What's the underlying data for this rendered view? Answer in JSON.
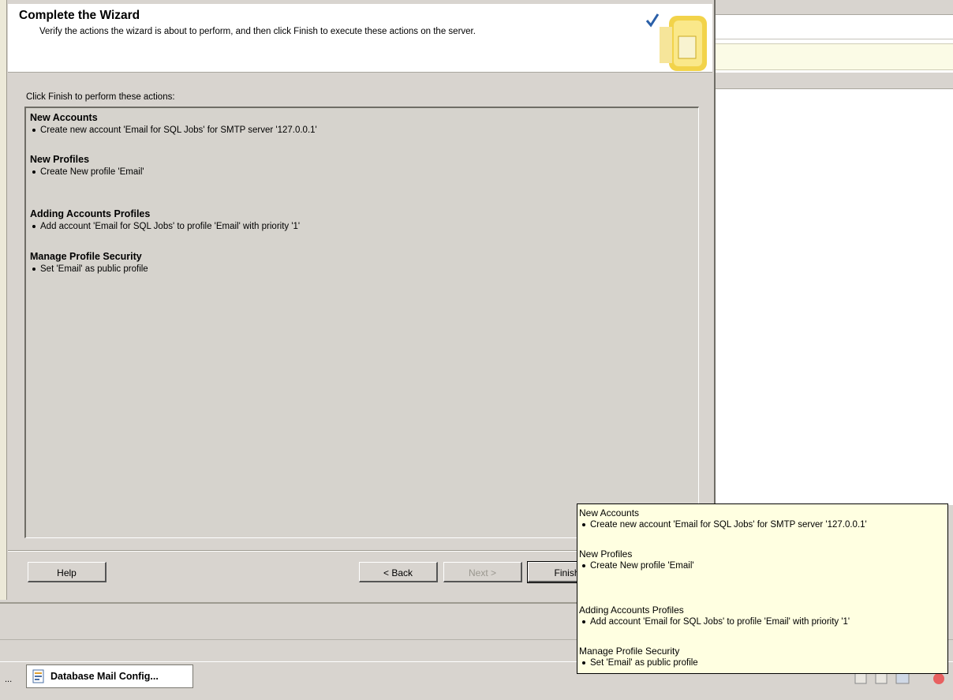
{
  "wizard": {
    "title": "Complete the Wizard",
    "subtitle": "Verify the actions the wizard is about to perform, and then click Finish to execute these actions on the server.",
    "icon": "wizard-complete-icon"
  },
  "actions": {
    "label": "Click Finish to perform these actions:",
    "sections": [
      {
        "heading": "New Accounts",
        "item": "Create new account 'Email for SQL Jobs' for SMTP server '127.0.0.1'"
      },
      {
        "heading": "New Profiles",
        "item": "Create New profile 'Email'"
      },
      {
        "heading": "Adding Accounts Profiles",
        "item": "Add account 'Email for SQL Jobs' to profile 'Email' with priority '1'"
      },
      {
        "heading": "Manage Profile Security",
        "item": "Set 'Email' as public profile"
      }
    ]
  },
  "buttons": {
    "help": "Help",
    "back": "< Back",
    "next": "Next >",
    "finish": "Finish"
  },
  "taskbar": {
    "ellipsis": "...",
    "app_label": "Database Mail Config..."
  },
  "tooltip": {
    "sections": [
      {
        "heading": "New Accounts",
        "item": "Create new account 'Email for SQL Jobs' for SMTP server '127.0.0.1'"
      },
      {
        "heading": "New Profiles",
        "item": "Create New profile 'Email'"
      },
      {
        "heading": "Adding Accounts Profiles",
        "item": "Add account 'Email for SQL Jobs' to profile 'Email' with priority '1'"
      },
      {
        "heading": "Manage Profile Security",
        "item": "Set 'Email' as public profile"
      }
    ]
  },
  "colors": {
    "dialog_bg": "#d8d4cf",
    "tooltip_bg": "#ffffe1",
    "header_bg": "#ffffff",
    "check_blue": "#2a5fa8"
  }
}
